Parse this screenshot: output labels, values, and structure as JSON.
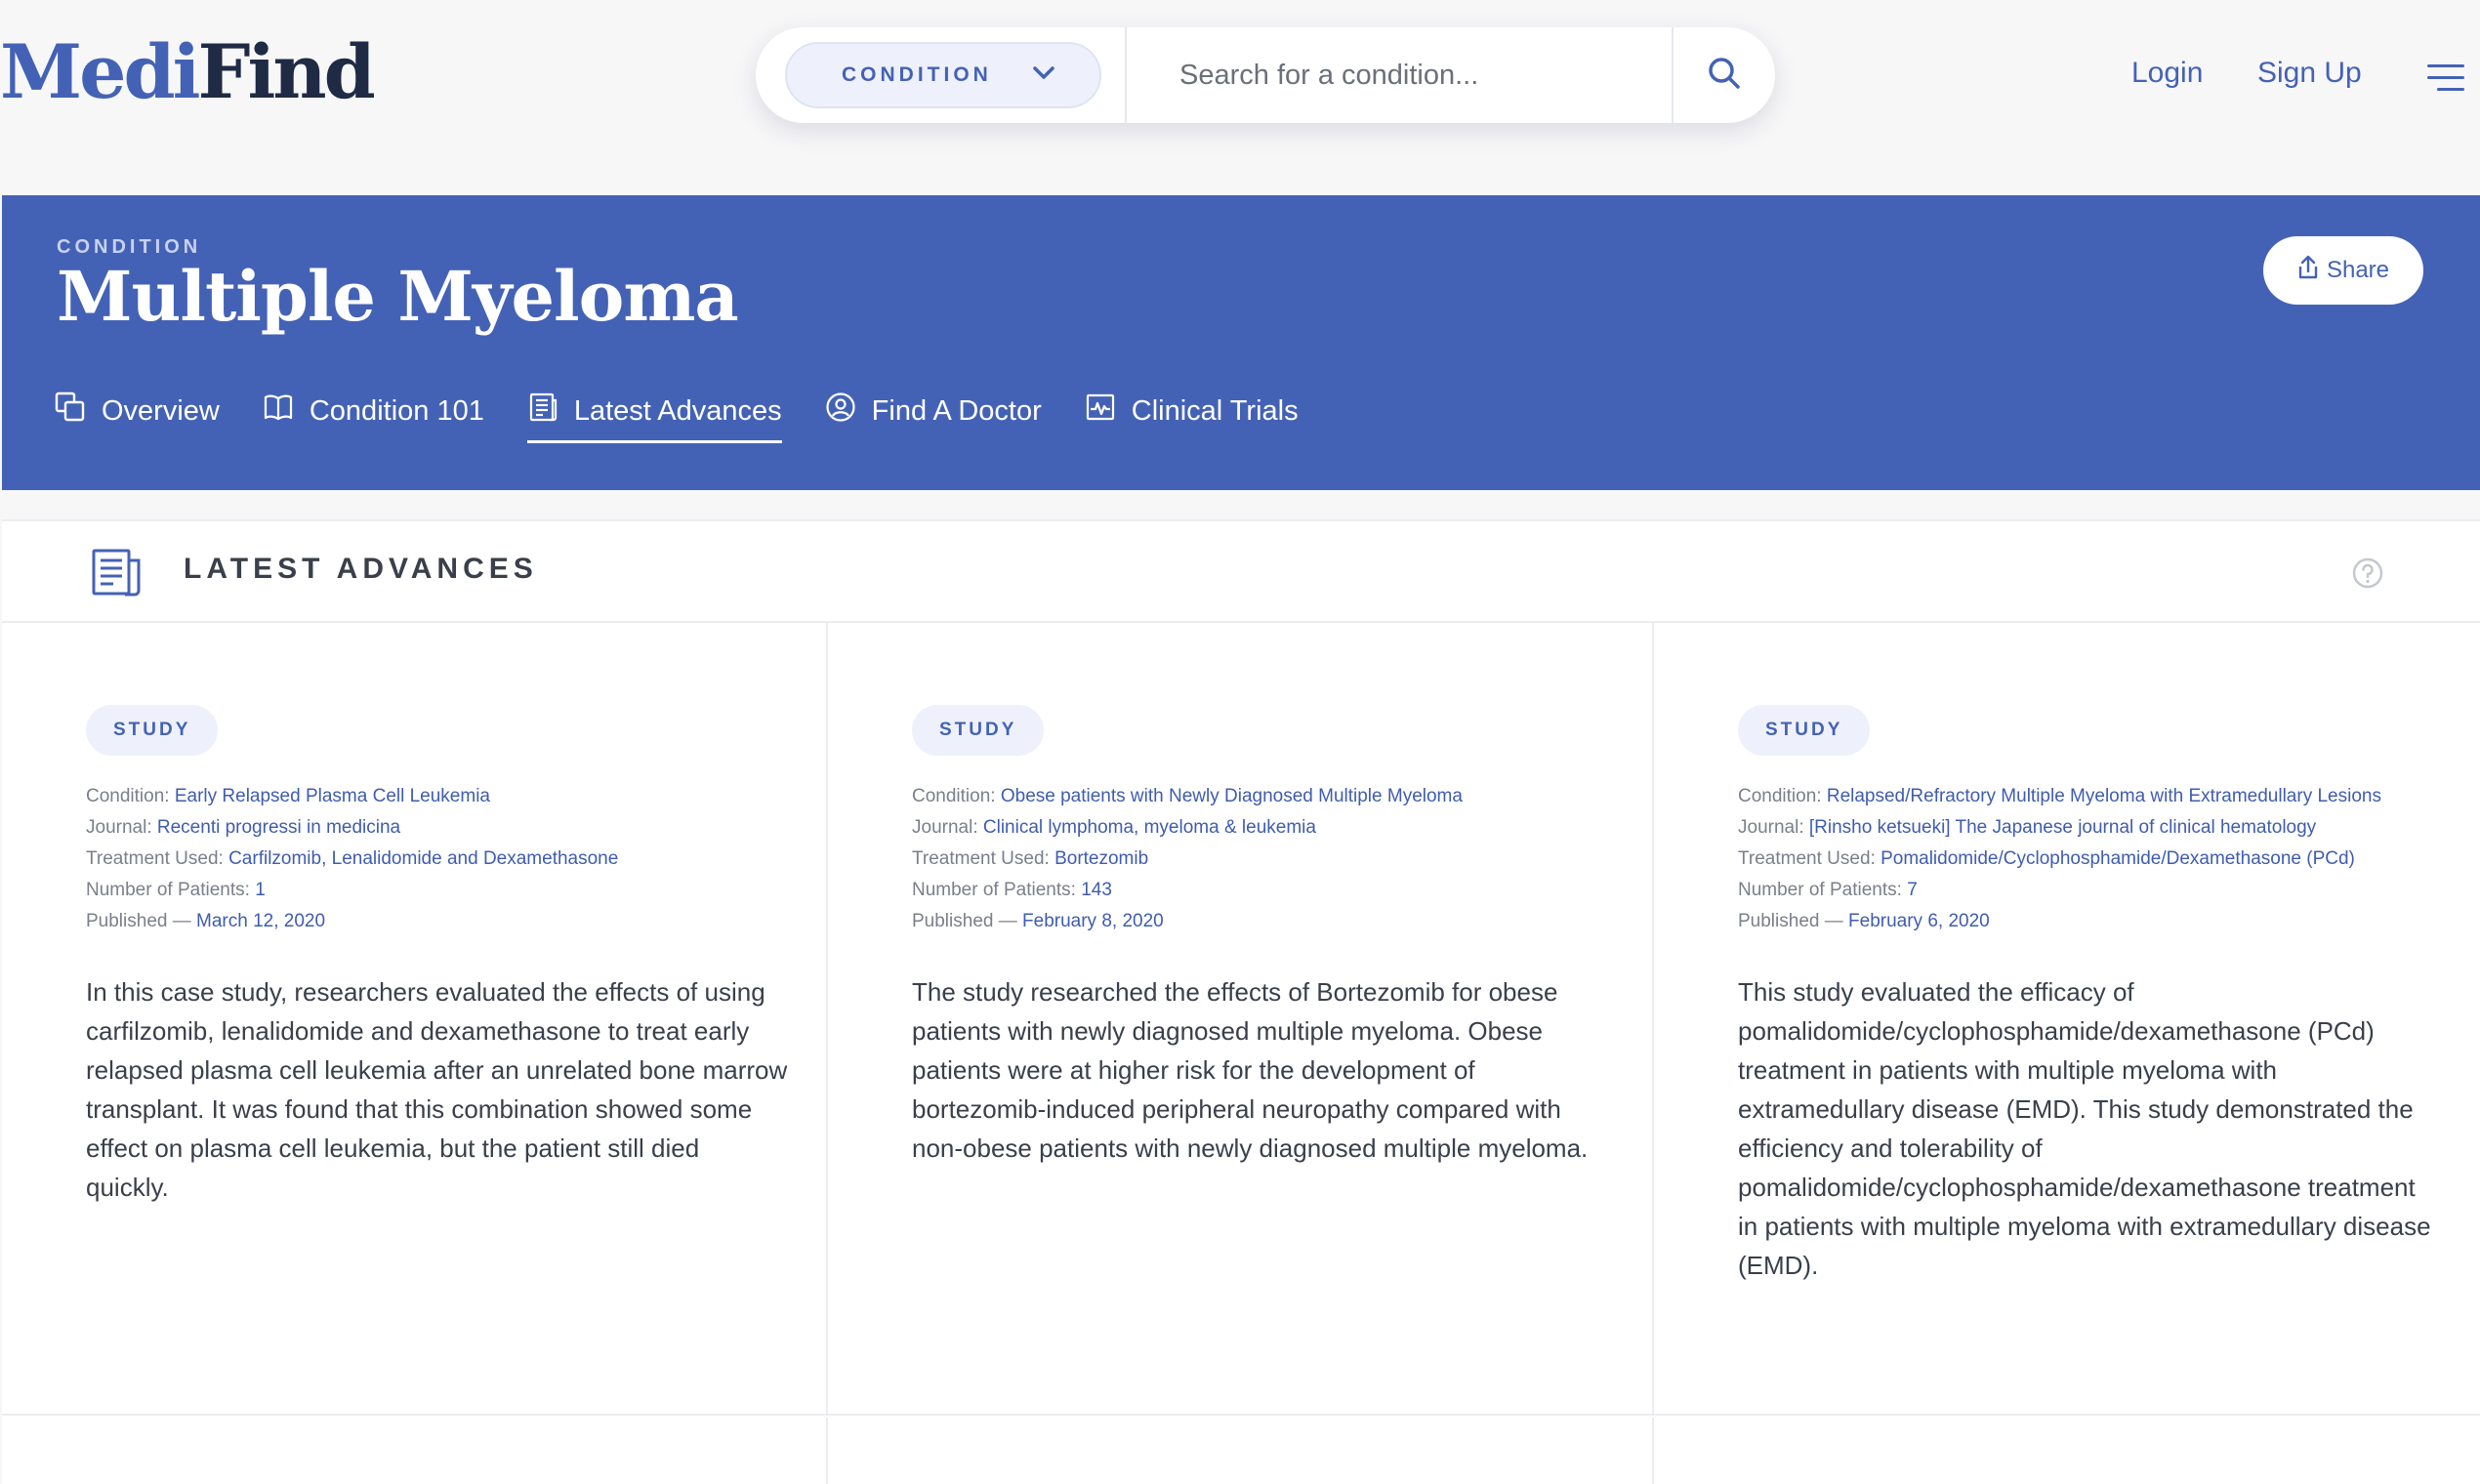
{
  "brand": {
    "part1": "Medi",
    "part2": "Find"
  },
  "search": {
    "category_label": "CONDITION",
    "placeholder": "Search for a condition..."
  },
  "nav": {
    "login": "Login",
    "signup": "Sign Up"
  },
  "hero": {
    "eyebrow": "CONDITION",
    "title": "Multiple Myeloma",
    "share_label": "Share",
    "tabs": [
      {
        "label": "Overview",
        "icon": "copy-icon"
      },
      {
        "label": "Condition 101",
        "icon": "book-icon"
      },
      {
        "label": "Latest Advances",
        "icon": "newspaper-icon",
        "active": true
      },
      {
        "label": "Find A Doctor",
        "icon": "doctor-icon"
      },
      {
        "label": "Clinical Trials",
        "icon": "chart-pulse-icon"
      }
    ]
  },
  "section": {
    "title": "LATEST ADVANCES"
  },
  "labels": {
    "condition": "Condition:",
    "journal": "Journal:",
    "treatment": "Treatment Used:",
    "patients": "Number of Patients:",
    "published": "Published —"
  },
  "cards": [
    {
      "badge": "STUDY",
      "condition": "Early Relapsed Plasma Cell Leukemia",
      "journal": "Recenti progressi in medicina",
      "treatment": "Carfilzomib, Lenalidomide and Dexamethasone",
      "patients": "1",
      "published": "March 12, 2020",
      "summary": "In this case study, researchers evaluated the effects of using carfilzomib, lenalidomide and dexamethasone to treat early relapsed plasma cell leukemia after an unrelated bone marrow transplant. It was found that this combination showed some effect on plasma cell leukemia, but the patient still died quickly."
    },
    {
      "badge": "STUDY",
      "condition": "Obese patients with Newly Diagnosed Multiple Myeloma",
      "journal": "Clinical lymphoma, myeloma & leukemia",
      "treatment": "Bortezomib",
      "patients": "143",
      "published": "February 8, 2020",
      "summary": "The study researched the effects of Bortezomib for obese patients with newly diagnosed multiple myeloma. Obese patients were at higher risk for the development of bortezomib-induced peripheral neuropathy compared with non-obese patients with newly diagnosed multiple myeloma."
    },
    {
      "badge": "STUDY",
      "condition": "Relapsed/Refractory Multiple Myeloma with Extramedullary Lesions",
      "journal": "[Rinsho ketsueki] The Japanese journal of clinical hematology",
      "treatment": "Pomalidomide/Cyclophosphamide/Dexamethasone (PCd)",
      "patients": "7",
      "published": "February 6, 2020",
      "summary": "This study evaluated the efficacy of pomalidomide/cyclophosphamide/dexamethasone (PCd) treatment in patients with multiple myeloma with extramedullary disease (EMD). This study demonstrated the efficiency and tolerability of pomalidomide/cyclophosphamide/dexamethasone treatment in patients with multiple myeloma with extramedullary disease (EMD)."
    }
  ],
  "colors": {
    "brand_blue": "#4462b5",
    "brand_dark": "#1f2a44",
    "badge_bg": "#eef1fb",
    "link": "#3f5cb0"
  }
}
